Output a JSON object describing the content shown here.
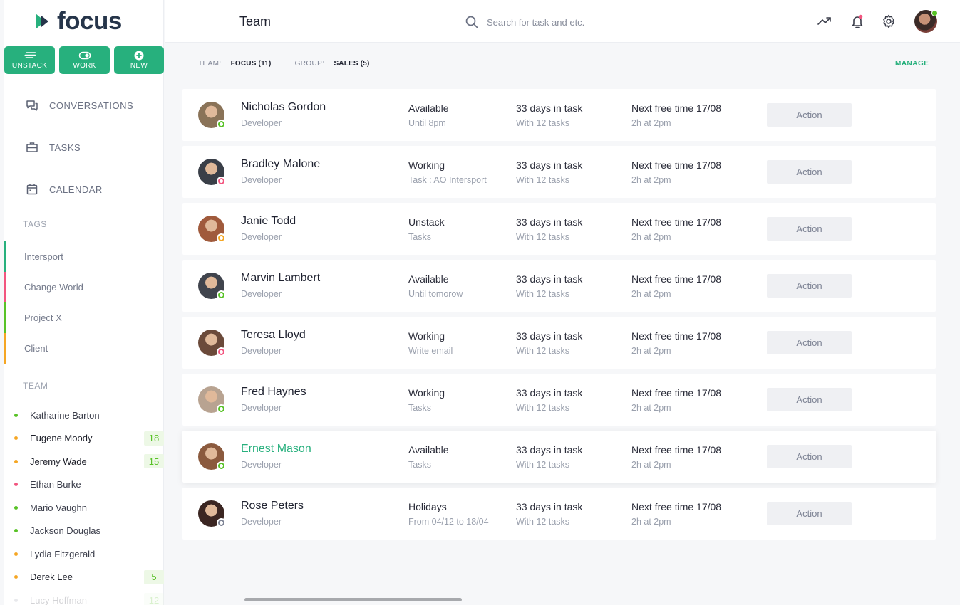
{
  "brand": {
    "name": "focus",
    "accent": "#27b07d"
  },
  "quick_actions": [
    {
      "label": "UNSTACK",
      "icon": "stack-lines-icon"
    },
    {
      "label": "WORK",
      "icon": "toggle-icon"
    },
    {
      "label": "NEW",
      "icon": "plus-circle-icon"
    }
  ],
  "nav": [
    {
      "label": "CONVERSATIONS",
      "icon": "chat-icon"
    },
    {
      "label": "TASKS",
      "icon": "briefcase-icon"
    },
    {
      "label": "CALENDAR",
      "icon": "calendar-icon"
    }
  ],
  "tags_title": "TAGS",
  "tags": [
    {
      "label": "Intersport",
      "color": "#27b07d"
    },
    {
      "label": "Change World",
      "color": "#f2557f"
    },
    {
      "label": "Project X",
      "color": "#58c226"
    },
    {
      "label": "Client",
      "color": "#f5a623"
    }
  ],
  "team_title": "TEAM",
  "team": [
    {
      "name": "Katharine Barton",
      "dot": "#58c226",
      "count": ""
    },
    {
      "name": "Eugene Moody",
      "dot": "#f5a623",
      "count": "18"
    },
    {
      "name": "Jeremy Wade",
      "dot": "#f5a623",
      "count": "15"
    },
    {
      "name": "Ethan Burke",
      "dot": "#f2557f",
      "count": ""
    },
    {
      "name": "Mario Vaughn",
      "dot": "#58c226",
      "count": ""
    },
    {
      "name": "Jackson Douglas",
      "dot": "#58c226",
      "count": ""
    },
    {
      "name": "Lydia Fitzgerald",
      "dot": "#f5a623",
      "count": ""
    },
    {
      "name": "Derek Lee",
      "dot": "#f5a623",
      "count": "5"
    },
    {
      "name": "Lucy Hoffman",
      "dot": "#9aa0ad",
      "count": "12"
    }
  ],
  "header": {
    "title": "Team",
    "search_placeholder": "Search for task and etc."
  },
  "filters": {
    "team_label": "TEAM:",
    "team_value": "FOCUS (11)",
    "group_label": "GROUP:",
    "group_value": "SALES (5)",
    "manage": "MANAGE"
  },
  "members": [
    {
      "name": "Nicholas Gordon",
      "role": "Developer",
      "status": "Available",
      "status_detail": "Until 8pm",
      "days": "33 days in task",
      "tasks": "With 12 tasks",
      "free": "Next free time 17/08",
      "free_detail": "2h at 2pm",
      "action": "Action",
      "status_color": "#58c226",
      "avatar_color": "#8a7358"
    },
    {
      "name": "Bradley Malone",
      "role": "Developer",
      "status": "Working",
      "status_detail": "Task : AO Intersport",
      "days": "33 days in task",
      "tasks": "With 12 tasks",
      "free": "Next free time 17/08",
      "free_detail": "2h at 2pm",
      "action": "Action",
      "status_color": "#f2557f",
      "avatar_color": "#3a3f48"
    },
    {
      "name": "Janie Todd",
      "role": "Developer",
      "status": "Unstack",
      "status_detail": "Tasks",
      "days": "33 days in task",
      "tasks": "With 12 tasks",
      "free": "Next free time 17/08",
      "free_detail": "2h at 2pm",
      "action": "Action",
      "status_color": "#f5a623",
      "avatar_color": "#a05a3c"
    },
    {
      "name": "Marvin Lambert",
      "role": "Developer",
      "status": "Available",
      "status_detail": "Until tomorow",
      "days": "33 days in task",
      "tasks": "With 12 tasks",
      "free": "Next free time 17/08",
      "free_detail": "2h at 2pm",
      "action": "Action",
      "status_color": "#58c226",
      "avatar_color": "#40444d"
    },
    {
      "name": "Teresa Lloyd",
      "role": "Developer",
      "status": "Working",
      "status_detail": "Write email",
      "days": "33 days in task",
      "tasks": "With 12 tasks",
      "free": "Next free time 17/08",
      "free_detail": "2h at 2pm",
      "action": "Action",
      "status_color": "#f2557f",
      "avatar_color": "#6b4a3a"
    },
    {
      "name": "Fred Haynes",
      "role": "Developer",
      "status": "Working",
      "status_detail": "Tasks",
      "days": "33 days in task",
      "tasks": "With 12 tasks",
      "free": "Next free time 17/08",
      "free_detail": "2h at 2pm",
      "action": "Action",
      "status_color": "#58c226",
      "avatar_color": "#b8a391"
    },
    {
      "name": "Ernest Mason",
      "role": "Developer",
      "status": "Available",
      "status_detail": "Tasks",
      "days": "33 days in task",
      "tasks": "With 12 tasks",
      "free": "Next free time 17/08",
      "free_detail": "2h at 2pm",
      "action": "Action",
      "status_color": "#58c226",
      "avatar_color": "#8b5a3e",
      "highlight": true
    },
    {
      "name": "Rose Peters",
      "role": "Developer",
      "status": "Holidays",
      "status_detail": "From 04/12 to 18/04",
      "days": "33 days in task",
      "tasks": "With 12 tasks",
      "free": "Next free time 17/08",
      "free_detail": "2h at 2pm",
      "action": "Action",
      "status_color": "#7d8394",
      "avatar_color": "#3b2622"
    }
  ]
}
